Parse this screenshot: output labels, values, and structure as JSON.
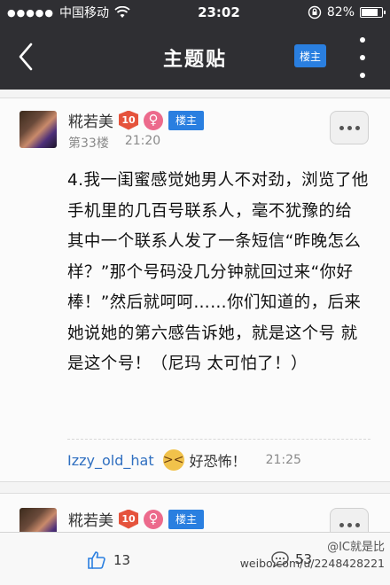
{
  "statusbar": {
    "signal": "●●●●●",
    "carrier": "中国移动",
    "time": "23:02",
    "battery_text": "82%",
    "battery_level": 0.82
  },
  "navbar": {
    "title": "主题贴",
    "owner_label": "楼主"
  },
  "post": {
    "author": "糀若美",
    "level": "10",
    "gender_symbol": "♀",
    "role": "楼主",
    "floor": "第33楼",
    "time": "21:20",
    "body": "4.我一闺蜜感觉她男人不对劲，浏览了他手机里的几百号联系人，毫不犹豫的给其中一个联系人发了一条短信“昨晚怎么样？”那个号码没几分钟就回过来“你好棒！”然后就呵呵……你们知道的，后来她说她的第六感告诉她，就是这个号 就是这个号！（尼玛 太可怕了！）",
    "reply": {
      "user": "Izzy_old_hat",
      "text": "好恐怖！",
      "time": "21:25"
    }
  },
  "post2": {
    "author": "糀若美",
    "level": "10",
    "gender_symbol": "♀",
    "role": "楼主"
  },
  "bottombar": {
    "likes": "13",
    "comments": "53",
    "watermark_1": "@IC就是比",
    "watermark_2": "weibo.com/u/2248428221"
  },
  "colors": {
    "topbar": "#2f2f33",
    "accent_blue": "#2a7fe0",
    "level_red": "#e5533c",
    "female_pink": "#ec6a8c",
    "reply_user_blue": "#2f6fc0"
  },
  "icons": [
    "back-chevron-icon",
    "more-dots-icon",
    "thumbs-up-icon",
    "comment-bubble-icon",
    "female-icon",
    "scared-emoji-icon",
    "wifi-icon",
    "lock-rotation-icon"
  ]
}
